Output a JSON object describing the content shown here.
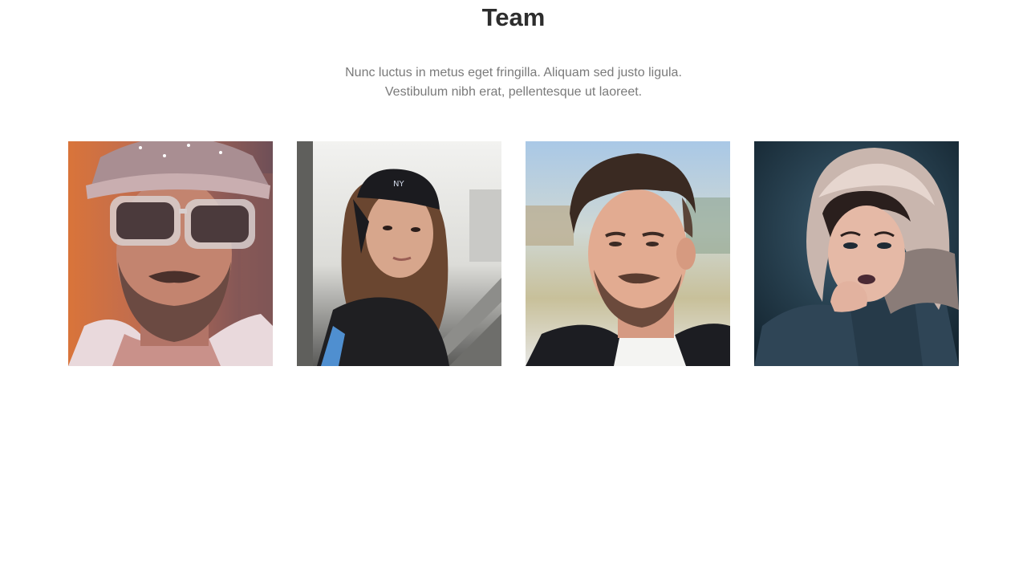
{
  "section": {
    "title": "Team",
    "subtitle_line1": "Nunc luctus in metus eget fringilla. Aliquam sed justo ligula.",
    "subtitle_line2": "Vestibulum nibh erat, pellentesque ut laoreet."
  },
  "team": {
    "members": [
      {
        "photo": "man-with-cap-and-sunglasses-photo"
      },
      {
        "photo": "woman-with-backwards-cap-photo"
      },
      {
        "photo": "man-with-pompadour-haircut-photo"
      },
      {
        "photo": "woman-in-fur-hood-photo"
      }
    ]
  },
  "colors": {
    "title": "#2d2d2d",
    "subtitle": "#7a7a7a",
    "background": "#ffffff"
  }
}
